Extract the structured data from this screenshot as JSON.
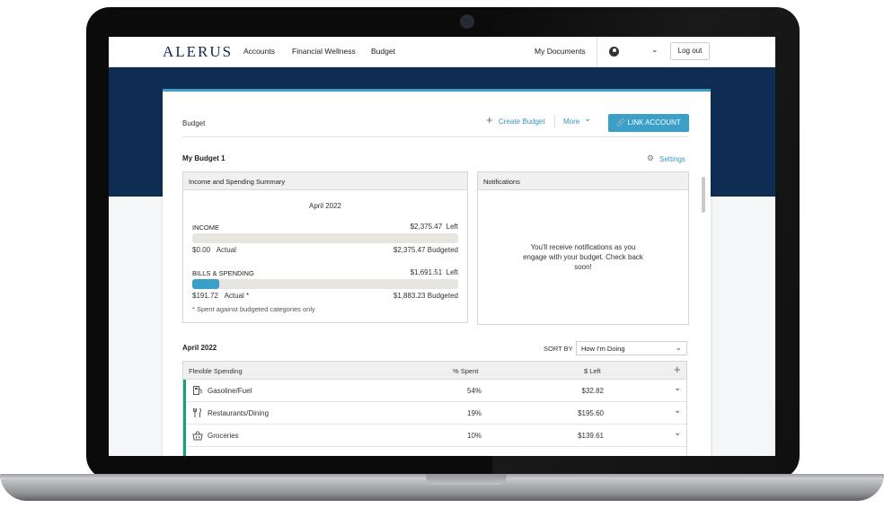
{
  "nav": {
    "logo": "ALERUS",
    "items": [
      "Accounts",
      "Financial Wellness",
      "Budget"
    ],
    "my_documents": "My Documents",
    "logout": "Log out"
  },
  "budget": {
    "title": "Budget",
    "create": "Create Budget",
    "more": "More",
    "link_account": "LINK ACCOUNT",
    "name": "My Budget 1",
    "settings": "Settings"
  },
  "summary": {
    "title": "Income and Spending Summary",
    "month": "April 2022",
    "income": {
      "label": "INCOME",
      "left_value": "$2,375.47",
      "left_label": "Left",
      "actual_value": "$0.00",
      "actual_label": "Actual",
      "budgeted_value": "$2,375.47",
      "budgeted_label": "Budgeted",
      "progress": 0.0
    },
    "bills": {
      "label": "BILLS & SPENDING",
      "left_value": "$1,691.51",
      "left_label": "Left",
      "actual_value": "$191.72",
      "actual_label": "Actual *",
      "budgeted_value": "$1,883.23",
      "budgeted_label": "Budgeted",
      "progress": 0.102
    },
    "footnote": "* Spent against budgeted categories only"
  },
  "notifications": {
    "title": "Notifications",
    "line1": "You'll receive notifications as you",
    "line2": "engage with your budget. Check back",
    "line3": "soon!"
  },
  "list": {
    "month": "April 2022",
    "sort_label": "SORT BY",
    "sort_value": "How I'm Doing",
    "headers": {
      "category": "Flexible Spending",
      "pct": "% Spent",
      "left": "$ Left"
    },
    "rows": [
      {
        "name": "Gasoline/Fuel",
        "pct": "54%",
        "left": "$32.82",
        "icon": "fuel-pump-icon"
      },
      {
        "name": "Restaurants/Dining",
        "pct": "19%",
        "left": "$195.60",
        "icon": "utensils-icon"
      },
      {
        "name": "Groceries",
        "pct": "10%",
        "left": "$139.61",
        "icon": "basket-icon"
      }
    ]
  },
  "colors": {
    "brand_navy": "#0f2d52",
    "accent": "#3aa0c8",
    "category_green": "#17a07a"
  }
}
